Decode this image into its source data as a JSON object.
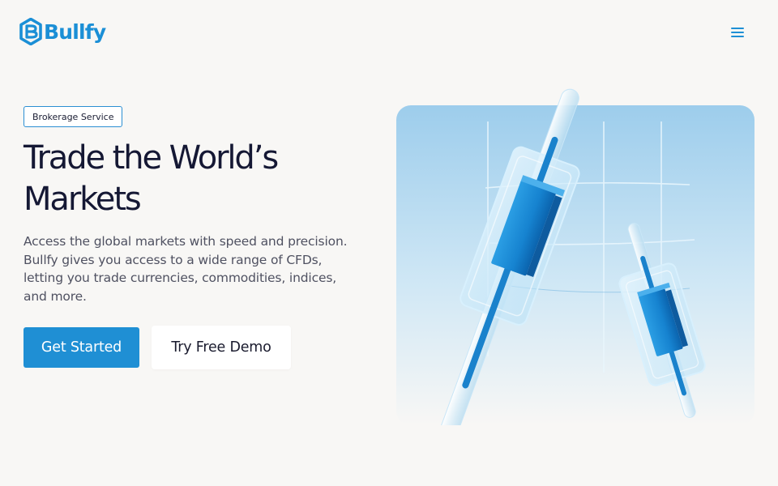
{
  "header": {
    "logo_text": "Bullfy",
    "menu_icon": "hamburger-menu-icon"
  },
  "hero": {
    "badge": "Brokerage Service",
    "title": "Trade the World’s Markets",
    "description": "Access the global markets with speed and precision. Bullfy gives you access to a wide range of CFDs, letting you trade currencies, commodities, indices, and more.",
    "primary_button": "Get Started",
    "secondary_button": "Try Free Demo",
    "image_subject": "glass-candlestick-illustration"
  },
  "colors": {
    "brand": "#1f8fd4",
    "heading": "#151834",
    "body_text": "#4f5161",
    "page_background": "#f8f7f5",
    "illustration_sky": "#a6d3ee"
  }
}
